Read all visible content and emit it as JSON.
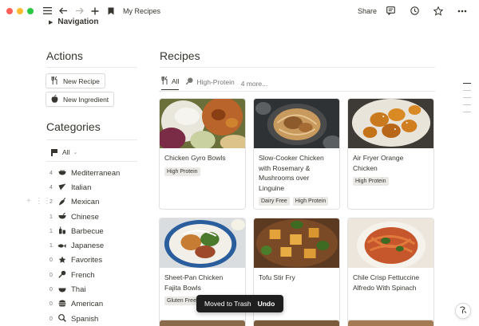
{
  "topbar": {
    "page_title": "My Recipes",
    "share_label": "Share",
    "icons": [
      "sidebar-menu-icon",
      "back-arrow-icon",
      "forward-arrow-icon",
      "add-icon",
      "bookmark-icon",
      "comment-icon",
      "history-clock-icon",
      "star-icon",
      "more-icon"
    ]
  },
  "navigation": {
    "label": "Navigation"
  },
  "actions": {
    "heading": "Actions",
    "buttons": [
      {
        "label": "New Recipe",
        "icon": "fork-knife-icon"
      },
      {
        "label": "New Ingredient",
        "icon": "apple-icon"
      }
    ]
  },
  "categories": {
    "heading": "Categories",
    "filter_label": "All",
    "items": [
      {
        "count": "4",
        "label": "Mediterranean",
        "icon": "bowl-icon"
      },
      {
        "count": "4",
        "label": "Italian",
        "icon": "pizza-icon"
      },
      {
        "count": "2",
        "label": "Mexican",
        "icon": "pepper-icon"
      },
      {
        "count": "1",
        "label": "Chinese",
        "icon": "bowl-icon"
      },
      {
        "count": "1",
        "label": "Barbecue",
        "icon": "grill-icon"
      },
      {
        "count": "1",
        "label": "Japanese",
        "icon": "fish-icon"
      },
      {
        "count": "0",
        "label": "Favorites",
        "icon": "star-icon"
      },
      {
        "count": "0",
        "label": "French",
        "icon": "whisk-icon"
      },
      {
        "count": "0",
        "label": "Thai",
        "icon": "bowl-icon"
      },
      {
        "count": "0",
        "label": "American",
        "icon": "burger-icon"
      },
      {
        "count": "0",
        "label": "Spanish",
        "icon": "pan-icon"
      }
    ]
  },
  "recipes": {
    "heading": "Recipes",
    "tabs": [
      {
        "label": "All",
        "icon": "fork-knife-icon",
        "active": true
      },
      {
        "label": "High-Protein",
        "icon": "drumstick-icon",
        "active": false
      }
    ],
    "more_tabs": "4 more...",
    "cards": [
      {
        "title": "Chicken Gyro Bowls",
        "tags": [
          "High Protein"
        ],
        "image": "gyro"
      },
      {
        "title": "Slow-Cooker Chicken with Rosemary & Mushrooms over Linguine",
        "tags": [
          "Dairy Free",
          "High Protein"
        ],
        "image": "linguine"
      },
      {
        "title": "Air Fryer Orange Chicken",
        "tags": [
          "High Protein"
        ],
        "image": "orange"
      },
      {
        "title": "Sheet-Pan Chicken Fajita Bowls",
        "tags": [
          "Gluten Free"
        ],
        "image": "fajita"
      },
      {
        "title": "Tofu Stir Fry",
        "tags": [],
        "image": "tofu"
      },
      {
        "title": "Chile Crisp Fettuccine Alfredo With Spinach",
        "tags": [],
        "image": "fettuccine"
      }
    ]
  },
  "toast": {
    "message": "Moved to Trash",
    "action": "Undo"
  },
  "colors": {
    "text": "#37352f",
    "muted": "#787774",
    "tag_bg": "#eae9e6",
    "toast_bg": "#1f1f1f"
  }
}
